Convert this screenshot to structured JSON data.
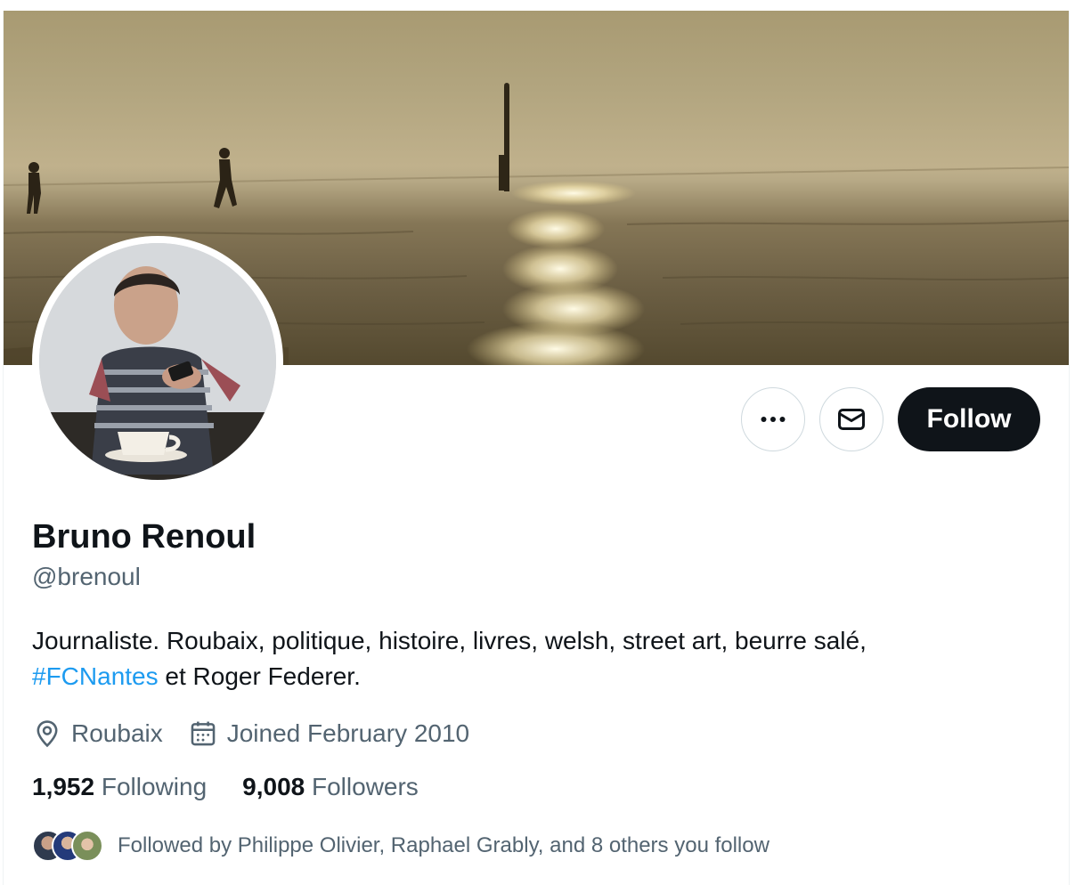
{
  "profile": {
    "name": "Bruno Renoul",
    "handle": "@brenoul",
    "bio_text": "Journaliste. Roubaix, politique, histoire, livres, welsh, street art, beurre salé,",
    "bio_hashtag": "#FCNantes",
    "bio_suffix": " et Roger Federer.",
    "location": "Roubaix",
    "joined": "Joined February 2010",
    "following_count": "1,952",
    "following_label": "Following",
    "followers_count": "9,008",
    "followers_label": "Followers",
    "followed_by": "Followed by Philippe Olivier, Raphael Grably, and 8 others you follow"
  },
  "actions": {
    "more_icon": "more-horizontal-icon",
    "message_icon": "envelope-icon",
    "follow_label": "Follow"
  },
  "icons": {
    "location": "location-pin-icon",
    "calendar": "calendar-icon"
  },
  "colors": {
    "primary_text": "#0f1419",
    "secondary_text": "#536471",
    "link": "#1d9bf0",
    "follow_button": "#0f1419",
    "border": "#cfd9de"
  }
}
